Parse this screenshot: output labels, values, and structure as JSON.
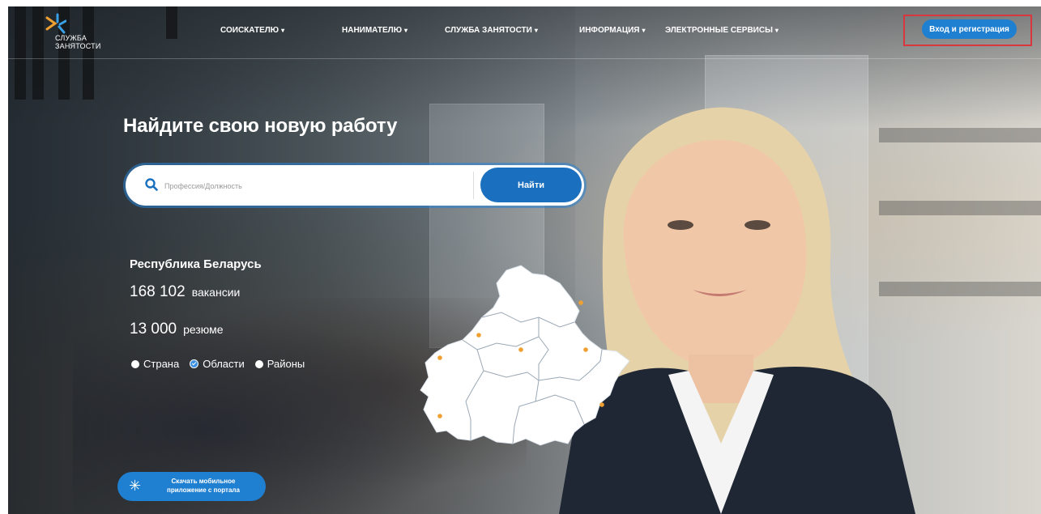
{
  "header": {
    "logo_line1": "СЛУЖБА",
    "logo_line2": "ЗАНЯТОСТИ",
    "nav": [
      {
        "label": "СОИСКАТЕЛЮ",
        "chevron": "▾"
      },
      {
        "label": "НАНИМАТЕЛЮ",
        "chevron": "▾"
      },
      {
        "label": "СЛУЖБА ЗАНЯТОСТИ",
        "chevron": "▾"
      },
      {
        "label": "ИНФОРМАЦИЯ",
        "chevron": "▾"
      },
      {
        "label": "ЭЛЕКТРОННЫЕ СЕРВИСЫ",
        "chevron": "▾"
      }
    ],
    "login_label": "Вход и регистрация"
  },
  "hero": {
    "title": "Найдите свою новую работу",
    "search_placeholder": "Профессия/Должность",
    "search_button": "Найти"
  },
  "stats": {
    "region": "Республика Беларусь",
    "vacancies_count": "168 102",
    "vacancies_label": "вакансии",
    "resumes_count": "13 000",
    "resumes_label": "резюме"
  },
  "filters": {
    "options": [
      {
        "label": "Страна",
        "checked": false
      },
      {
        "label": "Области",
        "checked": true
      },
      {
        "label": "Районы",
        "checked": false
      }
    ]
  },
  "app_download": {
    "label_line1": "Скачать мобильное",
    "label_line2": "приложение с портала"
  },
  "colors": {
    "primary": "#1f7fd0",
    "highlight_frame": "#d9363e",
    "map_marker": "#f0a030"
  }
}
